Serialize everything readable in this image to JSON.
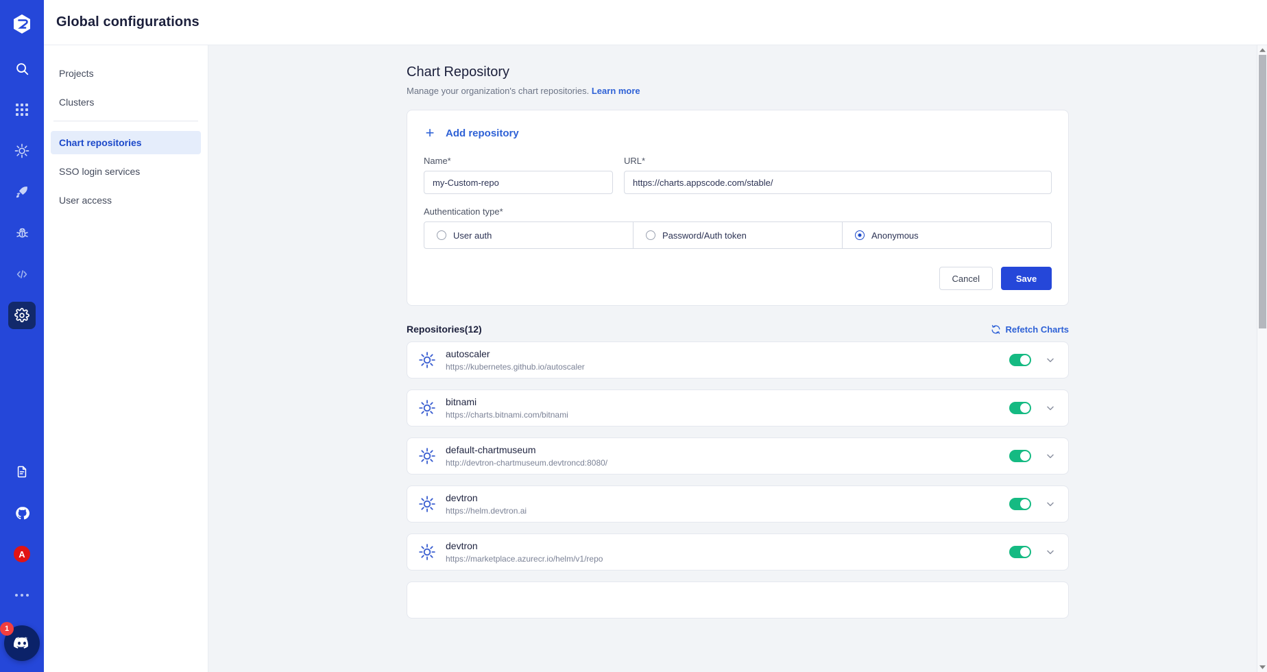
{
  "header": {
    "title": "Global configurations"
  },
  "rail": {
    "logo": "devtron-logo",
    "items": [
      {
        "name": "search-icon",
        "label": "Search"
      },
      {
        "name": "apps-grid-icon",
        "label": "Applications"
      },
      {
        "name": "helm-chart-icon",
        "label": "Charts"
      },
      {
        "name": "rocket-icon",
        "label": "Deployments"
      },
      {
        "name": "bug-icon",
        "label": "Security"
      },
      {
        "name": "code-icon",
        "label": "Code"
      },
      {
        "name": "gear-icon",
        "label": "Global configurations"
      }
    ],
    "bottom": {
      "docs_label": "Documentation",
      "github_label": "GitHub",
      "avatar_initial": "A",
      "more_label": "More",
      "discord_label": "Discord",
      "discord_badge": "1"
    }
  },
  "subnav": {
    "items": [
      {
        "label": "Projects",
        "active": false
      },
      {
        "label": "Clusters",
        "active": false
      },
      {
        "label": "Chart repositories",
        "active": true
      },
      {
        "label": "SSO login services",
        "active": false
      },
      {
        "label": "User access",
        "active": false
      }
    ]
  },
  "main": {
    "title": "Chart Repository",
    "subtitle": "Manage your organization's chart repositories.",
    "learn_more": "Learn more",
    "form": {
      "add_repository": "Add repository",
      "name_label": "Name*",
      "name_value": "my-Custom-repo",
      "name_placeholder": "Name",
      "url_label": "URL*",
      "url_value": "https://charts.appscode.com/stable/",
      "url_placeholder": "URL",
      "auth_label": "Authentication type*",
      "auth_options": [
        {
          "label": "User auth",
          "selected": false
        },
        {
          "label": "Password/Auth token",
          "selected": false
        },
        {
          "label": "Anonymous",
          "selected": true
        }
      ],
      "cancel_label": "Cancel",
      "save_label": "Save"
    },
    "repos_heading": "Repositories(12)",
    "refetch_label": "Refetch Charts",
    "repositories": [
      {
        "name": "autoscaler",
        "url": "https://kubernetes.github.io/autoscaler",
        "enabled": true
      },
      {
        "name": "bitnami",
        "url": "https://charts.bitnami.com/bitnami",
        "enabled": true
      },
      {
        "name": "default-chartmuseum",
        "url": "http://devtron-chartmuseum.devtroncd:8080/",
        "enabled": true
      },
      {
        "name": "devtron",
        "url": "https://helm.devtron.ai",
        "enabled": true
      },
      {
        "name": "devtron",
        "url": "https://marketplace.azurecr.io/helm/v1/repo",
        "enabled": true
      }
    ]
  },
  "colors": {
    "rail_blue": "#2547d9",
    "accent_blue": "#2e61d6",
    "active_nav_bg": "#e5edfb",
    "toggle_green": "#15ba82",
    "badge_red": "#f33e3e",
    "page_bg": "#f2f4f7"
  }
}
